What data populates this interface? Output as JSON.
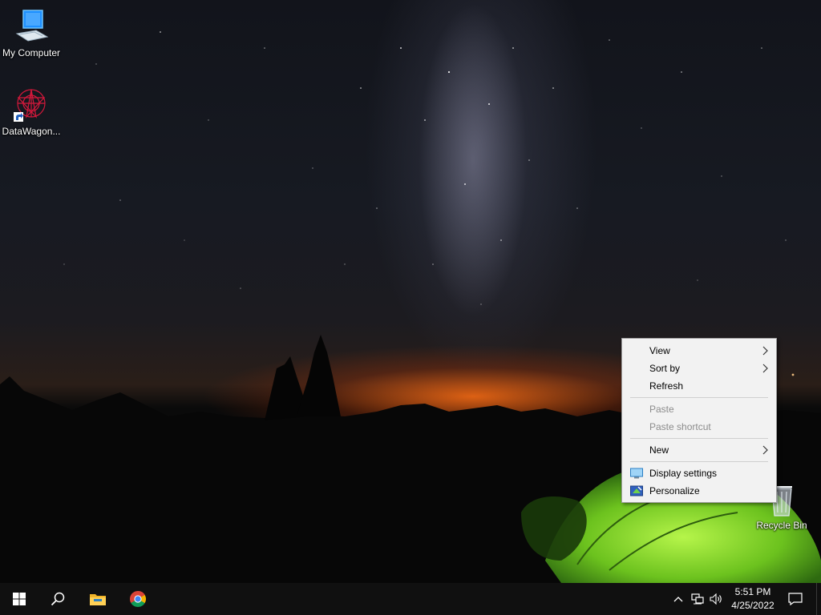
{
  "desktop": {
    "icons": [
      {
        "label": "My Computer",
        "icon": "my-computer-icon"
      },
      {
        "label": "DataWagon...",
        "icon": "datawagon-icon"
      },
      {
        "label": "Recycle Bin",
        "icon": "recycle-bin-icon"
      }
    ]
  },
  "context_menu": {
    "items": [
      {
        "label": "View",
        "submenu": true,
        "enabled": true
      },
      {
        "label": "Sort by",
        "submenu": true,
        "enabled": true
      },
      {
        "label": "Refresh",
        "submenu": false,
        "enabled": true
      },
      {
        "label": "Paste",
        "submenu": false,
        "enabled": false
      },
      {
        "label": "Paste shortcut",
        "submenu": false,
        "enabled": false
      },
      {
        "label": "New",
        "submenu": true,
        "enabled": true
      },
      {
        "label": "Display settings",
        "submenu": false,
        "enabled": true,
        "icon": "display-settings-icon"
      },
      {
        "label": "Personalize",
        "submenu": false,
        "enabled": true,
        "icon": "personalize-icon"
      }
    ]
  },
  "taskbar": {
    "pinned": [
      "start-icon",
      "search-icon",
      "file-explorer-icon",
      "chrome-icon"
    ],
    "tray": [
      "chevron-up-icon",
      "network-icon",
      "volume-icon"
    ],
    "clock": {
      "time": "5:51 PM",
      "date": "4/25/2022"
    },
    "notification_icon": "action-center-icon"
  },
  "colors": {
    "taskbar_bg": "#101010",
    "menu_bg": "#f2f2f2",
    "menu_disabled": "#8c8c8c",
    "tent_green": "#7ed321"
  }
}
